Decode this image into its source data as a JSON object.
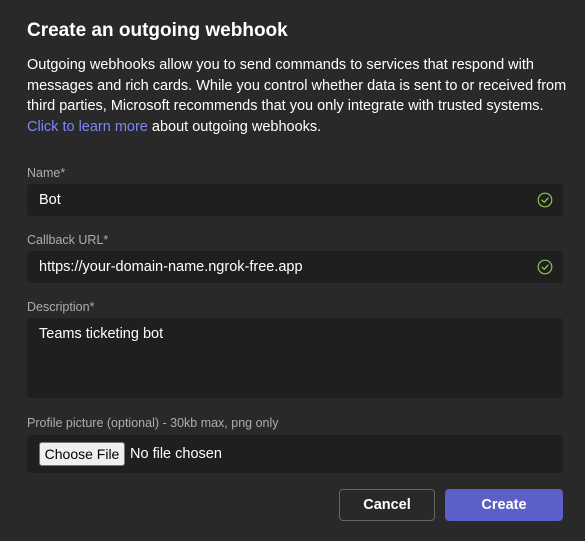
{
  "dialog": {
    "title": "Create an outgoing webhook",
    "description_text": "Outgoing webhooks allow you to send commands to services that respond with messages and rich cards. While you control whether data is sent to or received from third parties, Microsoft recommends that you only integrate with trusted systems. ",
    "learn_more_link": "Click to learn more",
    "description_suffix": " about outgoing webhooks."
  },
  "form": {
    "name": {
      "label": "Name*",
      "value": "Bot",
      "valid_icon": "check-circle-icon"
    },
    "callback_url": {
      "label": "Callback URL*",
      "value": "https://your-domain-name.ngrok-free.app",
      "valid_icon": "check-circle-icon"
    },
    "description": {
      "label": "Description*",
      "value": "Teams ticketing bot"
    },
    "profile_picture": {
      "label": "Profile picture (optional) - 30kb max, png only",
      "choose_button": "Choose File",
      "status": "No file chosen"
    }
  },
  "buttons": {
    "cancel": "Cancel",
    "create": "Create"
  },
  "colors": {
    "background": "#292929",
    "field_background": "#1f1f1f",
    "link": "#7f85f5",
    "primary": "#5b5fc7",
    "success": "#92c353"
  }
}
